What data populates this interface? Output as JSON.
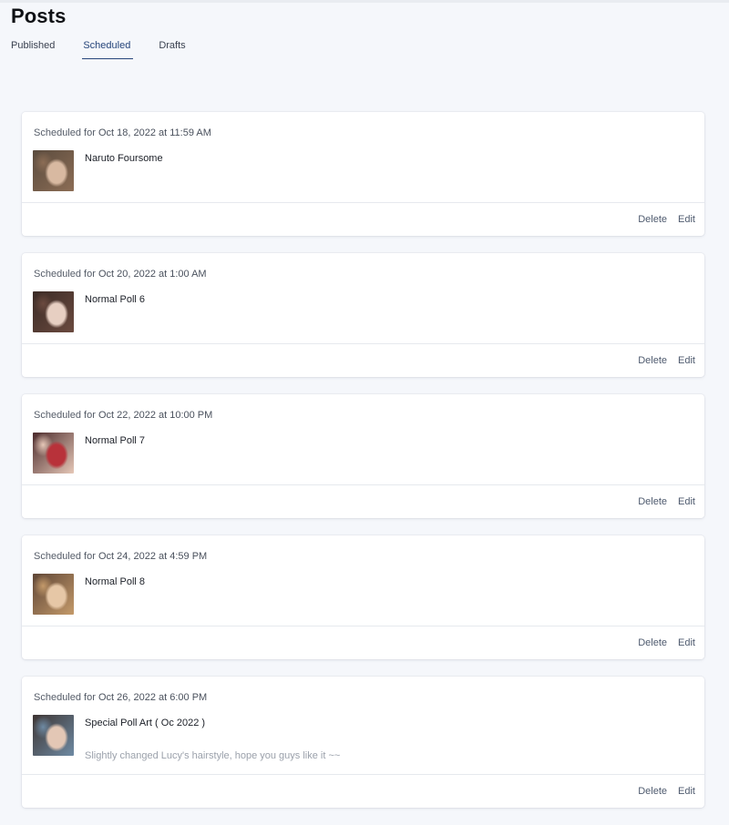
{
  "page": {
    "title": "Posts"
  },
  "tabs": [
    {
      "label": "Published",
      "active": false
    },
    {
      "label": "Scheduled",
      "active": true
    },
    {
      "label": "Drafts",
      "active": false
    }
  ],
  "actions": {
    "delete_label": "Delete",
    "edit_label": "Edit"
  },
  "posts": [
    {
      "scheduled_prefix": "Scheduled for",
      "date": "Oct 18, 2022 at 11:59 AM",
      "title": "Naruto Foursome",
      "description": "",
      "thumb_colors": [
        "#5a4b3e",
        "#d8b9a1",
        "#8c6d55"
      ]
    },
    {
      "scheduled_prefix": "Scheduled for",
      "date": "Oct 20, 2022 at 1:00 AM",
      "title": "Normal Poll 6",
      "description": "",
      "thumb_colors": [
        "#3a2b26",
        "#e7cfc2",
        "#6b4a3f"
      ]
    },
    {
      "scheduled_prefix": "Scheduled for",
      "date": "Oct 22, 2022 at 10:00 PM",
      "title": "Normal Poll 7",
      "description": "",
      "thumb_colors": [
        "#4b2a2b",
        "#b8323a",
        "#e6c8b8"
      ]
    },
    {
      "scheduled_prefix": "Scheduled for",
      "date": "Oct 24, 2022 at 4:59 PM",
      "title": "Normal Poll 8",
      "description": "",
      "thumb_colors": [
        "#5e4536",
        "#e6c7a6",
        "#c49a6a"
      ]
    },
    {
      "scheduled_prefix": "Scheduled for",
      "date": "Oct 26, 2022 at 6:00 PM",
      "title": "Special Poll Art ( Oc 2022 )",
      "description": "Slightly changed Lucy's hairstyle, hope you guys like it ~~",
      "thumb_colors": [
        "#3d3432",
        "#e3c7b5",
        "#6e8aa3"
      ]
    }
  ]
}
